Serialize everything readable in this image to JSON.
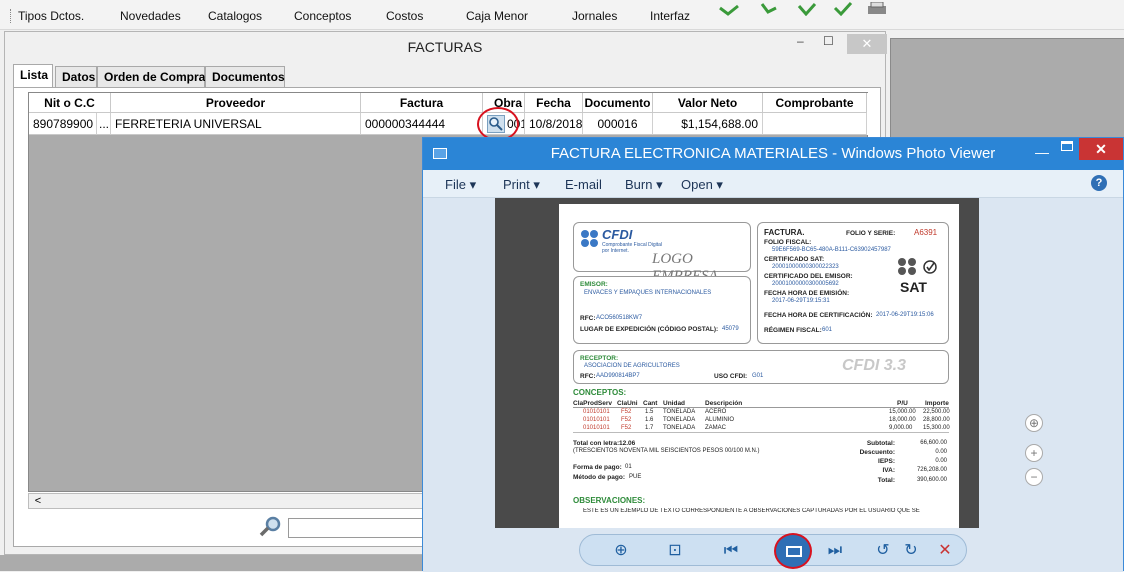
{
  "menubar": {
    "items": [
      "Tipos Dctos.",
      "Novedades",
      "Catalogos",
      "Conceptos",
      "Costos",
      "Caja Menor",
      "Jornales",
      "Interfaz"
    ]
  },
  "facturas": {
    "title": "FACTURAS",
    "tabs": [
      "Lista",
      "Datos",
      "Orden de Compra",
      "Documentos"
    ],
    "columns": [
      "Nit o C.C",
      "Proveedor",
      "Factura",
      "Obra",
      "Fecha",
      "Documento",
      "Valor Neto",
      "Comprobante"
    ],
    "rows": [
      {
        "nit": "890789900",
        "ellipsis": "...",
        "proveedor": "FERRETERIA UNIVERSAL",
        "factura": "000000344444",
        "obra": "001",
        "fecha": "10/8/2018",
        "documento": "000016",
        "valor_neto": "$1,154,688.00",
        "comprobante": ""
      }
    ]
  },
  "photo_viewer": {
    "title": "FACTURA ELECTRONICA MATERIALES - Windows Photo Viewer",
    "menu": [
      "File",
      "Print",
      "E-mail",
      "Burn",
      "Open"
    ]
  },
  "invoice": {
    "cfdi_brand": "CFDI",
    "cfdi_tagline_1": "Comprobante Fiscal Digital",
    "cfdi_tagline_2": "por Internet.",
    "logo": "LOGO EMPRESA",
    "factura_label": "FACTURA.",
    "folio_serie_label": "FOLIO Y SERIE:",
    "folio_serie": "A6391",
    "folio_fiscal_label": "FOLIO FISCAL:",
    "folio_fiscal": "59E6F569-BC65-480A-B111-C63902457987",
    "cert_sat_label": "CERTIFICADO SAT:",
    "cert_sat": "20001000000300022323",
    "cert_emisor_label": "CERTIFICADO DEL EMISOR:",
    "cert_emisor": "20001000000300005692",
    "fecha_emision_label": "FECHA HORA DE EMISIÓN:",
    "fecha_emision": "2017-06-29T19:15:31",
    "fecha_cert_label": "FECHA HORA DE CERTIFICACIÓN:",
    "fecha_cert": "2017-06-29T19:15:06",
    "regimen_label": "RÉGIMEN FISCAL:",
    "regimen": "601",
    "sat": "SAT",
    "emisor_label": "EMISOR:",
    "emisor": "ENVACES Y EMPAQUES INTERNACIONALES",
    "rfc_emisor_label": "RFC:",
    "rfc_emisor": "ACO560518KW7",
    "lugar_label": "LUGAR DE EXPEDICIÓN (CÓDIGO POSTAL):",
    "lugar": "45079",
    "receptor_label": "RECEPTOR:",
    "receptor": "ASOCIACION DE AGRICULTORES",
    "rfc_receptor_label": "RFC:",
    "rfc_receptor": "AAD990814BP7",
    "uso_cfdi_label": "USO CFDI:",
    "uso_cfdi": "G01",
    "cfdi_version": "CFDI 3.3",
    "conceptos_label": "CONCEPTOS:",
    "concept_headers": [
      "ClaProdServ",
      "ClaUni",
      "Cant",
      "Unidad",
      "Descripción",
      "P/U",
      "Importe"
    ],
    "concepts": [
      [
        "01010101",
        "F52",
        "1.5",
        "TONELADA",
        "ACERO",
        "15,000.00",
        "22,500.00"
      ],
      [
        "01010101",
        "F52",
        "1.6",
        "TONELADA",
        "ALUMINIO",
        "18,000.00",
        "28,800.00"
      ],
      [
        "01010101",
        "F52",
        "1.7",
        "TONELADA",
        "ZAMAC",
        "9,000.00",
        "15,300.00"
      ]
    ],
    "total_letra_label": "Total con letra:",
    "total_letra_value": "12.06",
    "total_letra": "(TRESCIENTOS NOVENTA MIL SEISCIENTOS PESOS 00/100 M.N.)",
    "forma_pago_label": "Forma de pago:",
    "forma_pago": "01",
    "metodo_pago_label": "Método de pago:",
    "metodo_pago": "PUE",
    "totals": [
      {
        "label": "Subtotal:",
        "value": "66,600.00"
      },
      {
        "label": "Descuento:",
        "value": "0.00"
      },
      {
        "label": "IEPS:",
        "value": "0.00"
      },
      {
        "label": "IVA:",
        "value": "726,208.00"
      },
      {
        "label": "Total:",
        "value": "390,600.00"
      }
    ],
    "observaciones_label": "OBSERVACIONES:",
    "observaciones": "ESTE ES UN EJEMPLO DE TEXTO CORRESPONDIENTE A OBSERVACIONES CAPTURADAS POR EL USUARIO QUE SE"
  }
}
